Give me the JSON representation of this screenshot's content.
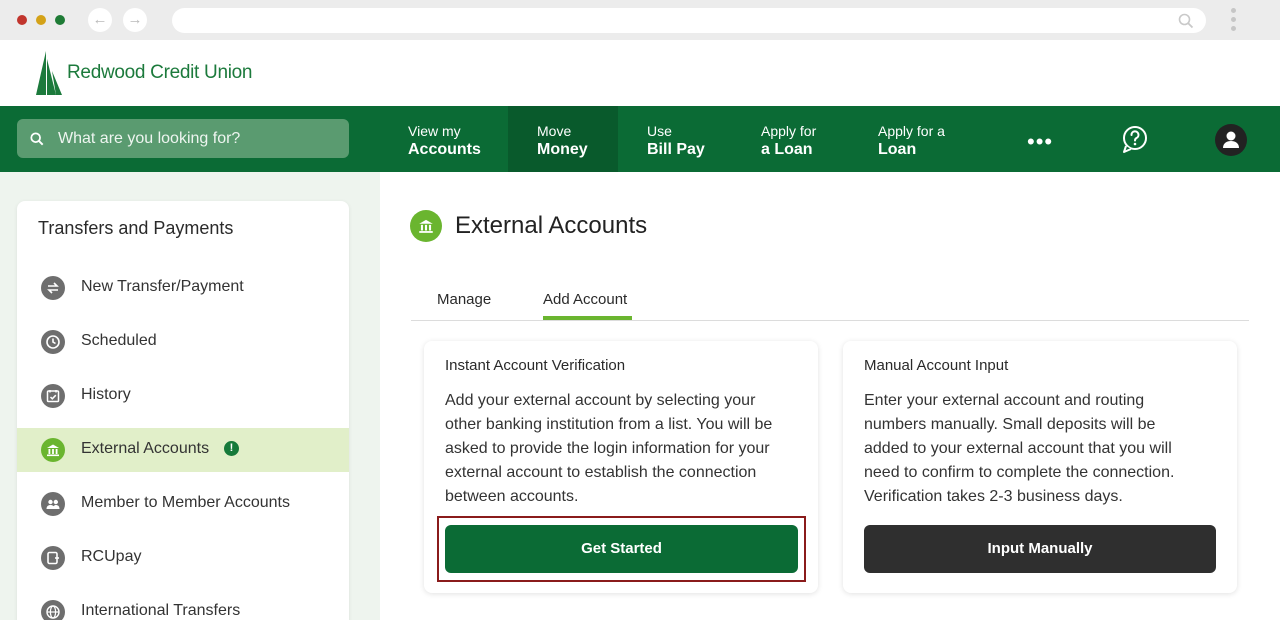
{
  "brand": {
    "name": "Redwood Credit Union",
    "primary": "#0b6b35",
    "accent": "#6ab52f"
  },
  "search": {
    "placeholder": "What are you looking for?"
  },
  "nav": {
    "items": [
      {
        "small": "View my",
        "big": "Accounts"
      },
      {
        "small": "Move",
        "big": "Money"
      },
      {
        "small": "Use",
        "big": "Bill Pay"
      },
      {
        "small": "Apply for",
        "big": "a Loan"
      },
      {
        "small": "Apply for a",
        "big": "Loan"
      }
    ],
    "more": "•••"
  },
  "sidebar": {
    "title": "Transfers and Payments",
    "items": [
      {
        "label": "New Transfer/Payment",
        "icon": "transfer-arrows-icon"
      },
      {
        "label": "Scheduled",
        "icon": "clock-icon"
      },
      {
        "label": "History",
        "icon": "calendar-check-icon"
      },
      {
        "label": "External Accounts",
        "icon": "bank-icon",
        "badge": "!"
      },
      {
        "label": "Member to Member Accounts",
        "icon": "people-icon"
      },
      {
        "label": "RCUpay",
        "icon": "rcupay-icon"
      },
      {
        "label": "International Transfers",
        "icon": "globe-icon"
      }
    ]
  },
  "page": {
    "title": "External Accounts",
    "tabs": [
      {
        "label": "Manage"
      },
      {
        "label": "Add Account"
      }
    ]
  },
  "cards": {
    "instant": {
      "title": "Instant Account Verification",
      "body": [
        "Add your external account by selecting your",
        "other banking institution from a list. You will be",
        "asked to provide the login information for your",
        "external account to establish the connection",
        "between accounts."
      ],
      "button": "Get Started"
    },
    "manual": {
      "title": "Manual Account Input",
      "body": [
        "Enter your external account and routing",
        "numbers manually. Small deposits will be",
        "added to your external account that you will",
        "need to confirm to complete the connection.",
        "Verification takes 2-3 business days."
      ],
      "button": "Input Manually"
    }
  }
}
